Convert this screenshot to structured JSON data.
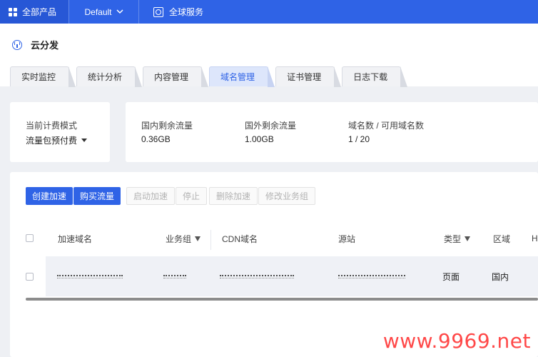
{
  "topbar": {
    "products_label": "全部产品",
    "default_label": "Default",
    "global_label": "全球服务"
  },
  "app": {
    "title": "云分发"
  },
  "tabs": [
    {
      "label": "实时监控"
    },
    {
      "label": "统计分析"
    },
    {
      "label": "内容管理"
    },
    {
      "label": "域名管理",
      "active": true
    },
    {
      "label": "证书管理"
    },
    {
      "label": "日志下载"
    }
  ],
  "billing": {
    "label": "当前计费模式",
    "value": "流量包预付费"
  },
  "stats": [
    {
      "label": "国内剩余流量",
      "value": "0.36GB"
    },
    {
      "label": "国外剩余流量",
      "value": "1.00GB"
    },
    {
      "label": "域名数 / 可用域名数",
      "value": "1 / 20"
    }
  ],
  "actions": {
    "create": "创建加速",
    "buy": "购买流量",
    "start": "启动加速",
    "stop": "停止",
    "delete": "删除加速",
    "modify_group": "修改业务组"
  },
  "table": {
    "columns": [
      "加速域名",
      "业务组",
      "CDN域名",
      "源站",
      "类型",
      "区域",
      "H"
    ],
    "rows": [
      {
        "type": "页面",
        "region": "国内"
      }
    ]
  },
  "watermark": "www.9969.net",
  "colors": {
    "primary": "#2f63e6",
    "watermark": "#ff4848"
  }
}
